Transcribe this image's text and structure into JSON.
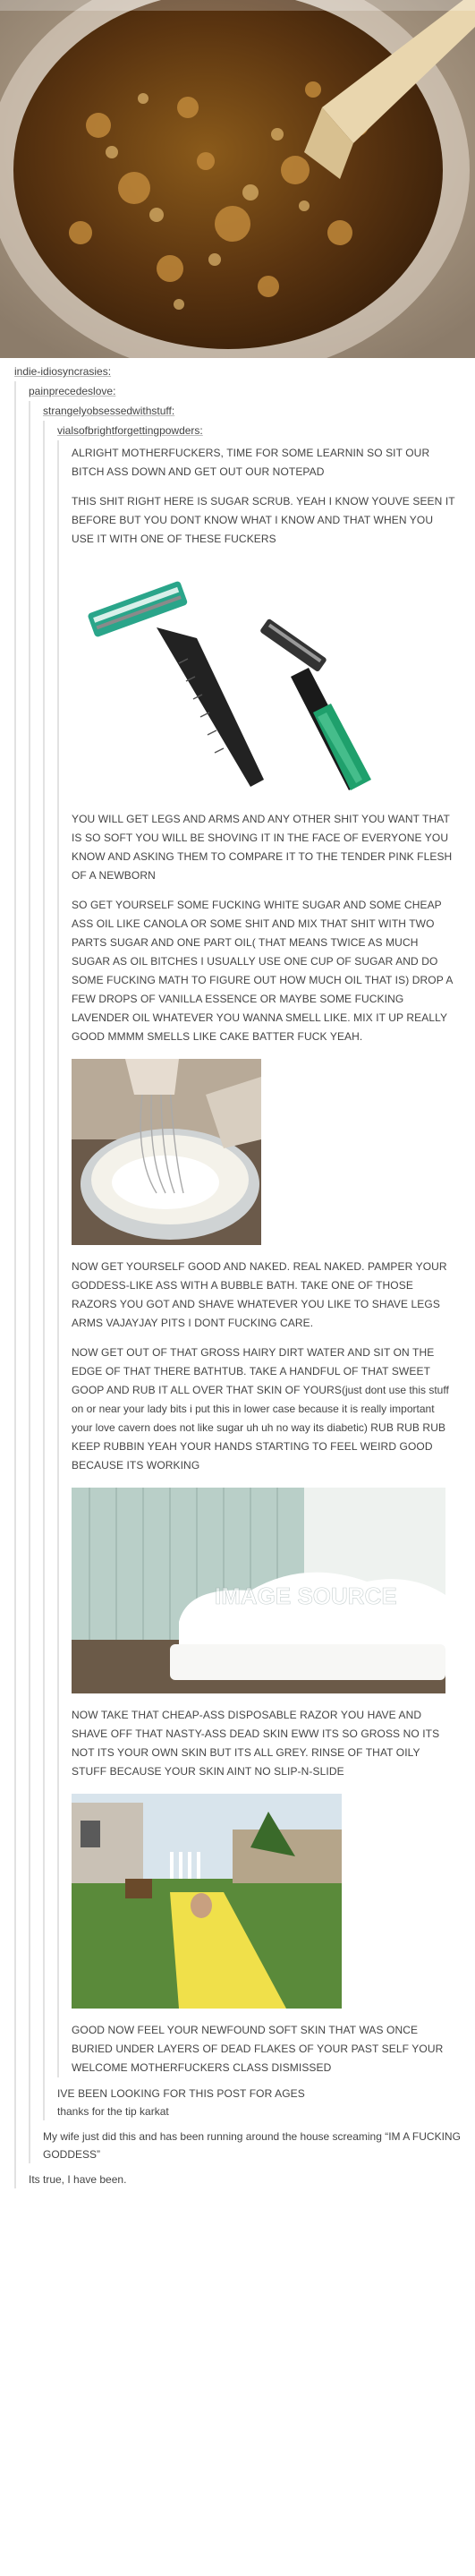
{
  "images": {
    "hero_alt": "sugar scrub in jar",
    "razor_alt": "disposable razors",
    "whisk_alt": "whisking in bowl",
    "bath_alt": "bubble bath",
    "bath_watermark": "IMAGE SOURCE",
    "slide_alt": "slip-n-slide"
  },
  "thread": {
    "level1_name": "indie-idiosyncrasies:",
    "level2_name": "painprecedeslove:",
    "level3_name": "strangelyobsessedwithstuff:",
    "level4_name": "vialsofbrightforgettingpowders:"
  },
  "post": {
    "p1": "ALRIGHT MOTHERFUCKERS, TIME FOR SOME LEARNIN SO SIT OUR BITCH ASS DOWN AND GET OUT OUR NOTEPAD",
    "p2": "THIS SHIT RIGHT HERE IS SUGAR SCRUB. YEAH I KNOW YOUVE SEEN IT BEFORE BUT YOU DONT KNOW WHAT I KNOW AND THAT WHEN YOU USE IT WITH ONE OF THESE FUCKERS",
    "p3": "YOU WILL GET LEGS AND ARMS AND ANY OTHER SHIT YOU WANT THAT IS SO SOFT YOU WILL BE SHOVING IT IN THE FACE OF EVERYONE YOU KNOW AND ASKING THEM TO COMPARE IT TO THE TENDER PINK FLESH OF A NEWBORN",
    "p4": "SO GET YOURSELF SOME FUCKING WHITE SUGAR AND SOME CHEAP ASS OIL LIKE CANOLA OR SOME SHIT AND MIX THAT SHIT WITH TWO PARTS SUGAR AND ONE PART OIL( THAT MEANS TWICE AS MUCH SUGAR AS OIL BITCHES I USUALLY USE ONE CUP OF SUGAR AND DO SOME FUCKING MATH TO FIGURE OUT HOW MUCH OIL THAT IS) DROP A FEW DROPS OF VANILLA ESSENCE OR MAYBE SOME FUCKING LAVENDER OIL WHATEVER YOU WANNA SMELL LIKE. MIX IT UP REALLY GOOD MMMM SMELLS LIKE CAKE BATTER FUCK YEAH.",
    "p5": "NOW GET YOURSELF GOOD AND NAKED. REAL NAKED. PAMPER YOUR GODDESS-LIKE ASS WITH A BUBBLE BATH. TAKE ONE OF THOSE RAZORS YOU GOT AND SHAVE WHATEVER YOU LIKE TO SHAVE LEGS ARMS VAJAYJAY PITS I DONT FUCKING CARE.",
    "p6a": "NOW GET OUT OF THAT GROSS HAIRY DIRT WATER AND SIT ON THE EDGE OF THAT THERE BATHTUB. TAKE A HANDFUL OF THAT SWEET GOOP AND RUB IT ALL OVER THAT SKIN OF YOURS",
    "p6b": "(just dont use this stuff on or near your lady bits i put this in lower case because it is really important your love cavern does not like sugar uh uh no way its diabetic)",
    "p6c": " RUB RUB RUB KEEP RUBBIN YEAH YOUR HANDS STARTING TO FEEL WEIRD GOOD BECAUSE ITS WORKING",
    "p7": "NOW TAKE THAT CHEAP-ASS DISPOSABLE RAZOR YOU HAVE AND SHAVE OFF THAT NASTY-ASS DEAD SKIN EWW ITS SO GROSS NO ITS NOT ITS YOUR OWN SKIN BUT ITS ALL GREY. RINSE OF THAT OILY STUFF BECAUSE YOUR SKIN AINT NO SLIP-N-SLIDE",
    "p8": "GOOD NOW FEEL YOUR NEWFOUND SOFT SKIN THAT WAS ONCE BURIED UNDER LAYERS OF DEAD FLAKES OF YOUR PAST SELF YOUR WELCOME MOTHERFUCKERS CLASS DISMISSED"
  },
  "replies": {
    "level3_reply": "IVE BEEN LOOKING FOR THIS POST FOR AGES",
    "level3_reply2": "thanks for the tip karkat",
    "level2_reply": "My wife just did this and has been running around the house screaming “IM A FUCKING GODDESS”",
    "level1_reply": "Its true, I have been."
  }
}
